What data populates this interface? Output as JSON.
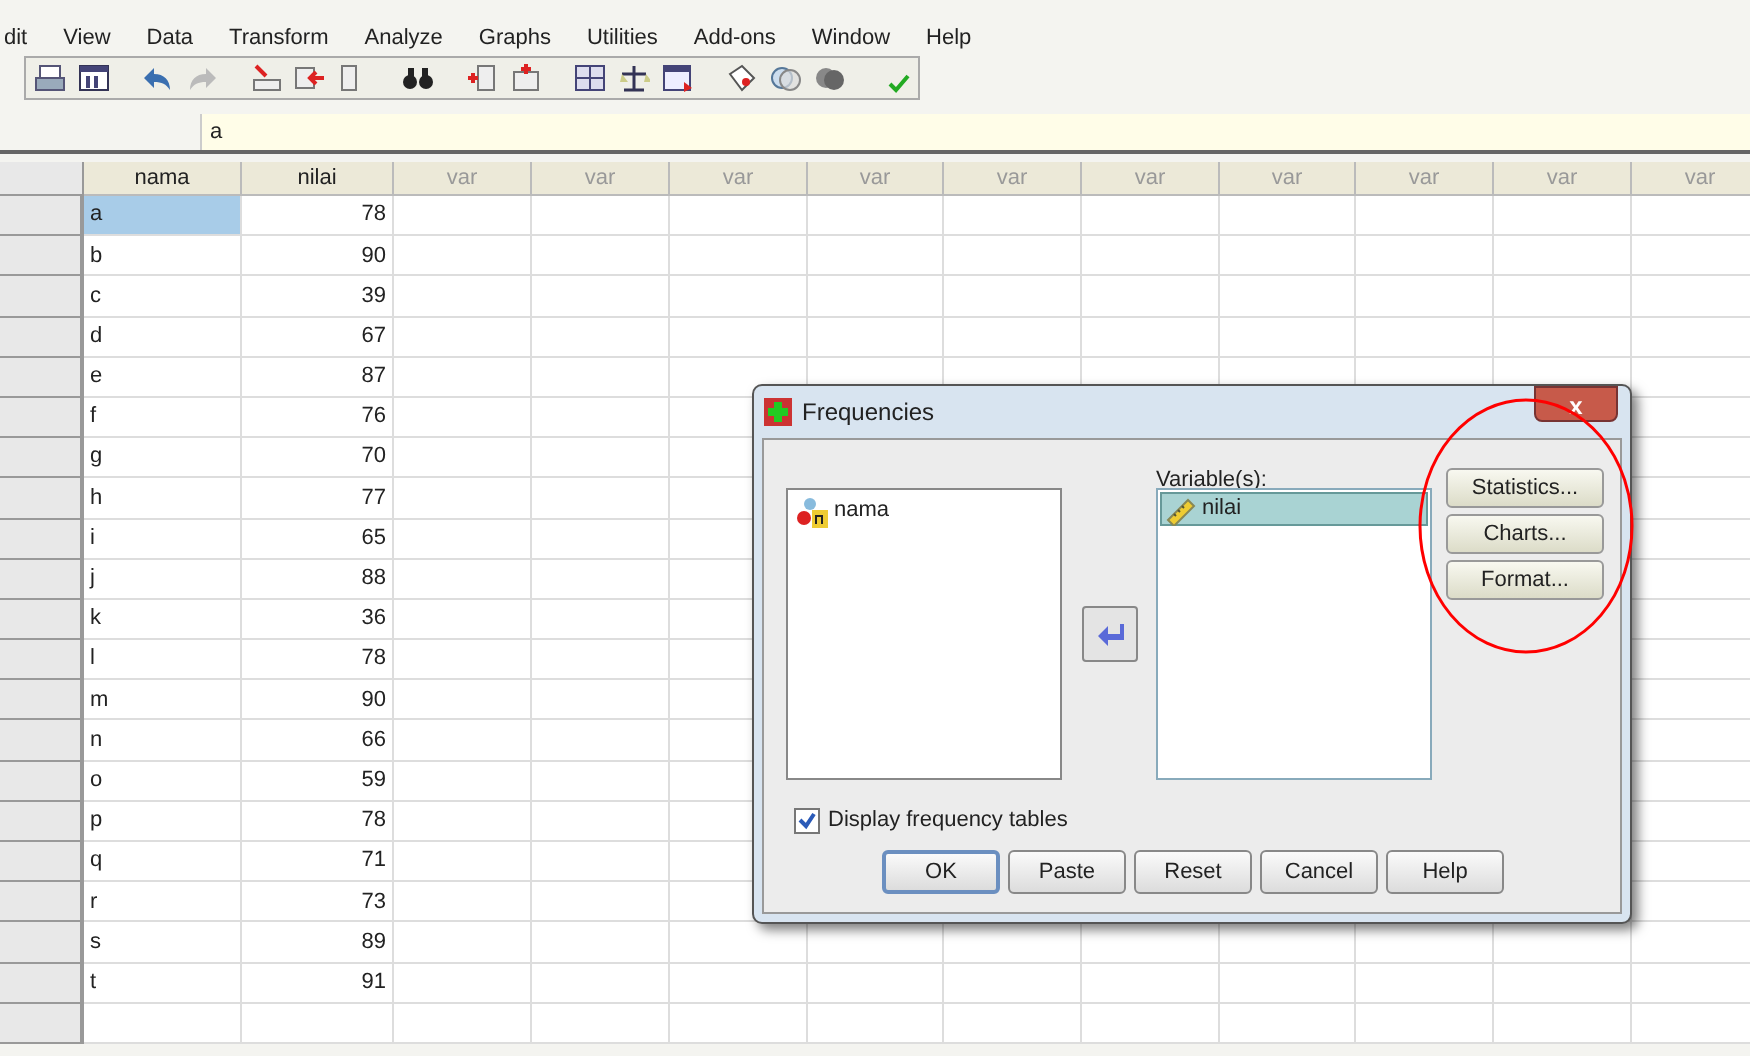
{
  "menu": [
    "dit",
    "View",
    "Data",
    "Transform",
    "Analyze",
    "Graphs",
    "Utilities",
    "Add-ons",
    "Window",
    "Help"
  ],
  "cell_editor": {
    "value": "a"
  },
  "grid": {
    "columns": [
      {
        "label": "nama",
        "kind": "defined"
      },
      {
        "label": "nilai",
        "kind": "defined"
      },
      {
        "label": "var",
        "kind": "empty"
      },
      {
        "label": "var",
        "kind": "empty"
      },
      {
        "label": "var",
        "kind": "empty"
      },
      {
        "label": "var",
        "kind": "empty"
      },
      {
        "label": "var",
        "kind": "empty"
      },
      {
        "label": "var",
        "kind": "empty"
      },
      {
        "label": "var",
        "kind": "empty"
      },
      {
        "label": "var",
        "kind": "empty"
      },
      {
        "label": "var",
        "kind": "empty"
      },
      {
        "label": "var",
        "kind": "empty"
      }
    ],
    "rows": [
      {
        "nama": "a",
        "nilai": "78",
        "selected": true
      },
      {
        "nama": "b",
        "nilai": "90",
        "selected": false
      },
      {
        "nama": "c",
        "nilai": "39",
        "selected": false
      },
      {
        "nama": "d",
        "nilai": "67",
        "selected": false
      },
      {
        "nama": "e",
        "nilai": "87",
        "selected": false
      },
      {
        "nama": "f",
        "nilai": "76",
        "selected": false
      },
      {
        "nama": "g",
        "nilai": "70",
        "selected": false
      },
      {
        "nama": "h",
        "nilai": "77",
        "selected": false
      },
      {
        "nama": "i",
        "nilai": "65",
        "selected": false
      },
      {
        "nama": "j",
        "nilai": "88",
        "selected": false
      },
      {
        "nama": "k",
        "nilai": "36",
        "selected": false
      },
      {
        "nama": "l",
        "nilai": "78",
        "selected": false
      },
      {
        "nama": "m",
        "nilai": "90",
        "selected": false
      },
      {
        "nama": "n",
        "nilai": "66",
        "selected": false
      },
      {
        "nama": "o",
        "nilai": "59",
        "selected": false
      },
      {
        "nama": "p",
        "nilai": "78",
        "selected": false
      },
      {
        "nama": "q",
        "nilai": "71",
        "selected": false
      },
      {
        "nama": "r",
        "nilai": "73",
        "selected": false
      },
      {
        "nama": "s",
        "nilai": "89",
        "selected": false
      },
      {
        "nama": "t",
        "nilai": "91",
        "selected": false
      }
    ]
  },
  "dialog": {
    "title": "Frequencies",
    "close": "x",
    "source_variables": [
      {
        "name": "nama",
        "kind": "string"
      }
    ],
    "target_label": "Variable(s):",
    "target_variables": [
      {
        "name": "nilai",
        "kind": "scale",
        "selected": true
      }
    ],
    "side_buttons": [
      "Statistics...",
      "Charts...",
      "Format..."
    ],
    "display_frequency_tables": {
      "label": "Display frequency tables",
      "checked": true
    },
    "buttons": [
      {
        "label": "OK",
        "default": true
      },
      {
        "label": "Paste",
        "default": false
      },
      {
        "label": "Reset",
        "default": false
      },
      {
        "label": "Cancel",
        "default": false
      },
      {
        "label": "Help",
        "default": false
      }
    ]
  },
  "annotation": {
    "kind": "ellipse",
    "color": "#ff0000"
  }
}
